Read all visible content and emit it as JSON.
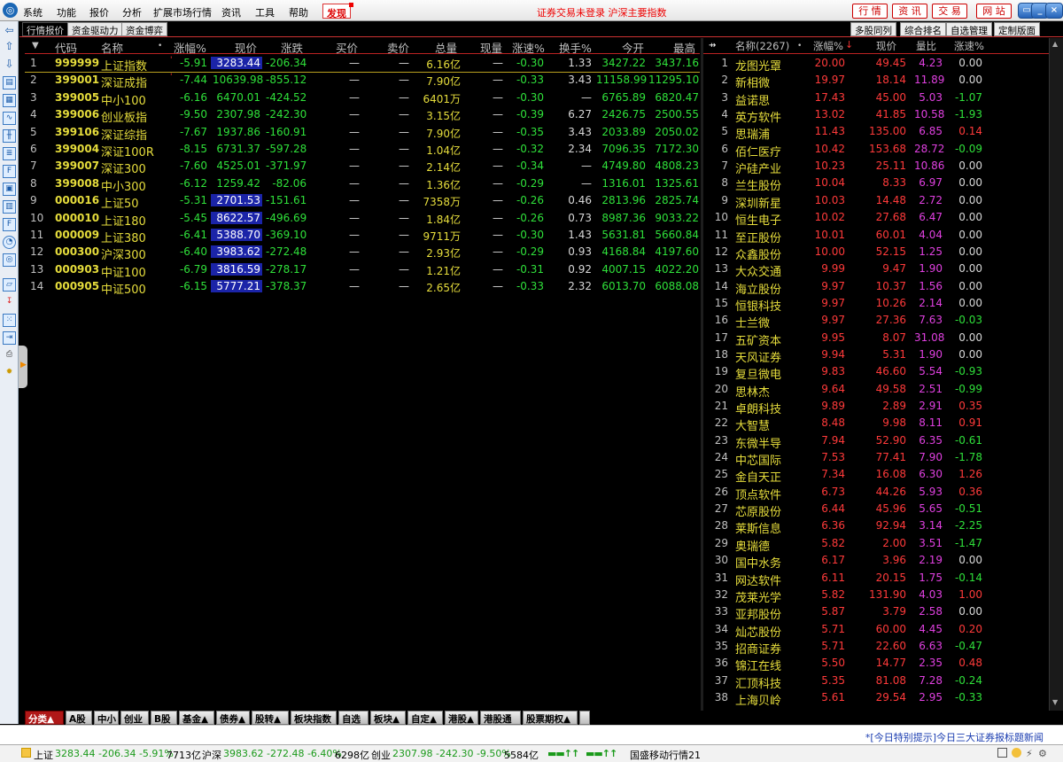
{
  "menu": {
    "items": [
      "系统",
      "功能",
      "报价",
      "分析",
      "扩展市场行情",
      "资讯",
      "工具",
      "帮助"
    ],
    "discover": "发现",
    "notice": "证券交易未登录  沪深主要指数",
    "top_buttons": [
      "行 情",
      "资 讯",
      "交 易",
      "网 站"
    ]
  },
  "subtabs": {
    "left": [
      "行情报价",
      "资金驱动力",
      "资金博弈"
    ],
    "right": [
      "多股同列",
      "综合排名",
      "自选管理",
      "定制版面"
    ]
  },
  "table": {
    "columns": [
      "代码",
      "名称",
      "涨幅%",
      "现价",
      "涨跌",
      "买价",
      "卖价",
      "总量",
      "现量",
      "涨速%",
      "换手%",
      "今开",
      "最高"
    ],
    "rows": [
      [
        "1",
        "999999",
        "上证指数",
        "-5.91",
        "3283.44",
        "-206.34",
        "—",
        "—",
        "6.16亿",
        "—",
        "-0.30",
        "1.33",
        "3427.22",
        "3437.16"
      ],
      [
        "2",
        "399001",
        "深证成指",
        "-7.44",
        "10639.98",
        "-855.12",
        "—",
        "—",
        "7.90亿",
        "—",
        "-0.33",
        "3.43",
        "11158.99",
        "11295.10"
      ],
      [
        "3",
        "399005",
        "中小100",
        "-6.16",
        "6470.01",
        "-424.52",
        "—",
        "—",
        "6401万",
        "—",
        "-0.30",
        "—",
        "6765.89",
        "6820.47"
      ],
      [
        "4",
        "399006",
        "创业板指",
        "-9.50",
        "2307.98",
        "-242.30",
        "—",
        "—",
        "3.15亿",
        "—",
        "-0.39",
        "6.27",
        "2426.75",
        "2500.55"
      ],
      [
        "5",
        "399106",
        "深证综指",
        "-7.67",
        "1937.86",
        "-160.91",
        "—",
        "—",
        "7.90亿",
        "—",
        "-0.35",
        "3.43",
        "2033.89",
        "2050.02"
      ],
      [
        "6",
        "399004",
        "深证100R",
        "-8.15",
        "6731.37",
        "-597.28",
        "—",
        "—",
        "1.04亿",
        "—",
        "-0.32",
        "2.34",
        "7096.35",
        "7172.30"
      ],
      [
        "7",
        "399007",
        "深证300",
        "-7.60",
        "4525.01",
        "-371.97",
        "—",
        "—",
        "2.14亿",
        "—",
        "-0.34",
        "—",
        "4749.80",
        "4808.23"
      ],
      [
        "8",
        "399008",
        "中小300",
        "-6.12",
        "1259.42",
        "-82.06",
        "—",
        "—",
        "1.36亿",
        "—",
        "-0.29",
        "—",
        "1316.01",
        "1325.61"
      ],
      [
        "9",
        "000016",
        "上证50",
        "-5.31",
        "2701.53",
        "-151.61",
        "—",
        "—",
        "7358万",
        "—",
        "-0.26",
        "0.46",
        "2813.96",
        "2825.74"
      ],
      [
        "10",
        "000010",
        "上证180",
        "-5.45",
        "8622.57",
        "-496.69",
        "—",
        "—",
        "1.84亿",
        "—",
        "-0.26",
        "0.73",
        "8987.36",
        "9033.22"
      ],
      [
        "11",
        "000009",
        "上证380",
        "-6.41",
        "5388.70",
        "-369.10",
        "—",
        "—",
        "9711万",
        "—",
        "-0.30",
        "1.43",
        "5631.81",
        "5660.84"
      ],
      [
        "12",
        "000300",
        "沪深300",
        "-6.40",
        "3983.62",
        "-272.48",
        "—",
        "—",
        "2.93亿",
        "—",
        "-0.29",
        "0.93",
        "4168.84",
        "4197.60"
      ],
      [
        "13",
        "000903",
        "中证100",
        "-6.79",
        "3816.59",
        "-278.17",
        "—",
        "—",
        "1.21亿",
        "—",
        "-0.31",
        "0.92",
        "4007.15",
        "4022.20"
      ],
      [
        "14",
        "000905",
        "中证500",
        "-6.15",
        "5777.21",
        "-378.37",
        "—",
        "—",
        "2.65亿",
        "—",
        "-0.33",
        "2.32",
        "6013.70",
        "6088.08"
      ]
    ],
    "highlight_rows": [
      1,
      9,
      10,
      11,
      12,
      13,
      14
    ]
  },
  "ranking": {
    "columns": [
      "名称(2267)",
      "涨幅%",
      "现价",
      "量比",
      "涨速%"
    ],
    "rows": [
      [
        "1",
        "龙图光罩",
        "20.00",
        "49.45",
        "4.23",
        "0.00"
      ],
      [
        "2",
        "新相微",
        "19.97",
        "18.14",
        "11.89",
        "0.00"
      ],
      [
        "3",
        "益诺思",
        "17.43",
        "45.00",
        "5.03",
        "-1.07"
      ],
      [
        "4",
        "英方软件",
        "13.02",
        "41.85",
        "10.58",
        "-1.93"
      ],
      [
        "5",
        "思瑞浦",
        "11.43",
        "135.00",
        "6.85",
        "0.14"
      ],
      [
        "6",
        "佰仁医疗",
        "10.42",
        "153.68",
        "28.72",
        "-0.09"
      ],
      [
        "7",
        "沪硅产业",
        "10.23",
        "25.11",
        "10.86",
        "0.00"
      ],
      [
        "8",
        "兰生股份",
        "10.04",
        "8.33",
        "6.97",
        "0.00"
      ],
      [
        "9",
        "深圳新星",
        "10.03",
        "14.48",
        "2.72",
        "0.00"
      ],
      [
        "10",
        "恒生电子",
        "10.02",
        "27.68",
        "6.47",
        "0.00"
      ],
      [
        "11",
        "至正股份",
        "10.01",
        "60.01",
        "4.04",
        "0.00"
      ],
      [
        "12",
        "众鑫股份",
        "10.00",
        "52.15",
        "1.25",
        "0.00"
      ],
      [
        "13",
        "大众交通",
        "9.99",
        "9.47",
        "1.90",
        "0.00"
      ],
      [
        "14",
        "海立股份",
        "9.97",
        "10.37",
        "1.56",
        "0.00"
      ],
      [
        "15",
        "恒银科技",
        "9.97",
        "10.26",
        "2.14",
        "0.00"
      ],
      [
        "16",
        "士兰微",
        "9.97",
        "27.36",
        "7.63",
        "-0.03"
      ],
      [
        "17",
        "五矿资本",
        "9.95",
        "8.07",
        "31.08",
        "0.00"
      ],
      [
        "18",
        "天风证券",
        "9.94",
        "5.31",
        "1.90",
        "0.00"
      ],
      [
        "19",
        "复旦微电",
        "9.83",
        "46.60",
        "5.54",
        "-0.93"
      ],
      [
        "20",
        "思林杰",
        "9.64",
        "49.58",
        "2.51",
        "-0.99"
      ],
      [
        "21",
        "卓朗科技",
        "9.89",
        "2.89",
        "2.91",
        "0.35"
      ],
      [
        "22",
        "大智慧",
        "8.48",
        "9.98",
        "8.11",
        "0.91"
      ],
      [
        "23",
        "东微半导",
        "7.94",
        "52.90",
        "6.35",
        "-0.61"
      ],
      [
        "24",
        "中芯国际",
        "7.53",
        "77.41",
        "7.90",
        "-1.78"
      ],
      [
        "25",
        "金自天正",
        "7.34",
        "16.08",
        "6.30",
        "1.26"
      ],
      [
        "26",
        "顶点软件",
        "6.73",
        "44.26",
        "5.93",
        "0.36"
      ],
      [
        "27",
        "芯原股份",
        "6.44",
        "45.96",
        "5.65",
        "-0.51"
      ],
      [
        "28",
        "莱斯信息",
        "6.36",
        "92.94",
        "3.14",
        "-2.25"
      ],
      [
        "29",
        "奥瑞德",
        "5.82",
        "2.00",
        "3.51",
        "-1.47"
      ],
      [
        "30",
        "国中水务",
        "6.17",
        "3.96",
        "2.19",
        "0.00"
      ],
      [
        "31",
        "网达软件",
        "6.11",
        "20.15",
        "1.75",
        "-0.14"
      ],
      [
        "32",
        "茂莱光学",
        "5.82",
        "131.90",
        "4.03",
        "1.00"
      ],
      [
        "33",
        "亚邦股份",
        "5.87",
        "3.79",
        "2.58",
        "0.00"
      ],
      [
        "34",
        "灿芯股份",
        "5.71",
        "60.00",
        "4.45",
        "0.20"
      ],
      [
        "35",
        "招商证券",
        "5.71",
        "22.60",
        "6.63",
        "-0.47"
      ],
      [
        "36",
        "锦江在线",
        "5.50",
        "14.77",
        "2.35",
        "0.48"
      ],
      [
        "37",
        "汇顶科技",
        "5.35",
        "81.08",
        "7.28",
        "-0.24"
      ],
      [
        "38",
        "上海贝岭",
        "5.61",
        "29.54",
        "2.95",
        "-0.33"
      ]
    ]
  },
  "bottom_tabs": [
    "分类▲",
    "A股",
    "中小",
    "创业",
    "B股",
    "基金▲",
    "债券▲",
    "股转▲",
    "板块指数",
    "自选",
    "板块▲",
    "自定▲",
    "港股▲",
    "港股通",
    "股票期权▲"
  ],
  "news": "*[今日特别提示]今日三大证券报标题新闻",
  "status": {
    "sh_label": "上证",
    "sh_values": "3283.44 -206.34 -5.91%",
    "sh_amount": "7713亿",
    "hs_label": "沪深",
    "hs_values": "3983.62 -272.48 -6.40%",
    "hs_amount": "6298亿",
    "cy_label": "创业",
    "cy_values": "2307.98 -242.30 -9.50%",
    "cy_amount": "5584亿",
    "server": "国盛移动行情21"
  },
  "colors": {
    "up": "#ff3a3a",
    "down": "#2fe03a",
    "neutral": "#d8d8d8",
    "code": "#e6dd3c",
    "bg": "#000000"
  }
}
